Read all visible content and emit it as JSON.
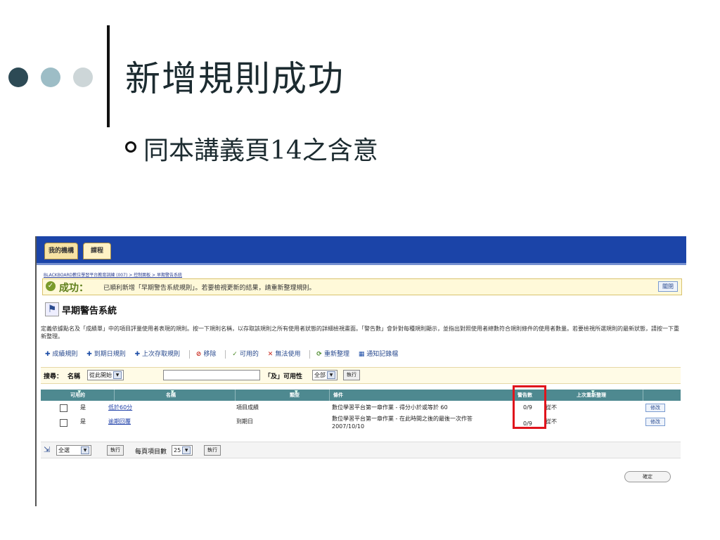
{
  "slide": {
    "title": "新增規則成功",
    "bullet": "同本講義頁14之含意"
  },
  "tabs": {
    "mine": "我的機構",
    "course": "課程"
  },
  "breadcrumb": "BLACKBOARD數位學習平台教育訓練 (007) > 控制面板 > 早期警告系統",
  "success": {
    "title": "成功：",
    "message": "已順利新增「早期警告系統規則」。若要檢視更新的結果，請重新整理規則。",
    "close_label": "關閉"
  },
  "section_title": "早期警告系統",
  "description": "定義依據點名及「成績單」中的項目評量使用者表現的規則。按一下規則名稱，以存取該規則之所有使用者狀態的詳細檢視畫面。「警告數」會針對每種規則顯示，並指出對照使用者總數符合規則條件的使用者數量。若要檢視所選規則的最新狀態，請按一下重新整理。",
  "actions": {
    "grade_rule": "成績規則",
    "due_rule": "到期日規則",
    "last_access_rule": "上次存取規則",
    "remove": "移除",
    "available": "可用的",
    "unavailable": "無法使用",
    "refresh": "重新整理",
    "notify_log": "通知記錄檔"
  },
  "search": {
    "label": "搜尋：",
    "name_label": "名稱",
    "match_option": "從此開始",
    "and_label": "「及」可用性",
    "availability_option": "全部",
    "go_label": "執行"
  },
  "table": {
    "headers": [
      "可用的",
      "名稱",
      "類型",
      "條件",
      "警告數",
      "上次重新整理"
    ],
    "rows": [
      {
        "available": "是",
        "name": "低於60分",
        "type": "項目成績",
        "condition": "數位學習平台第一章作業 - 得分小於或等於 60",
        "warnings": "0/9",
        "last_refresh": "從不",
        "edit": "修改"
      },
      {
        "available": "是",
        "name": "逾期回覆",
        "type": "到期日",
        "condition": "數位學習平台第一章作業 - 在此時間之後的最後一次作答 2007/10/10",
        "warnings": "0/9",
        "last_refresh": "從不",
        "edit": "修改"
      }
    ]
  },
  "bottom": {
    "select_option": "全選",
    "go_label": "執行",
    "per_page_label": "每頁項目數",
    "per_page_value": "25",
    "go_label_2": "執行"
  },
  "ok_label": "確定"
}
